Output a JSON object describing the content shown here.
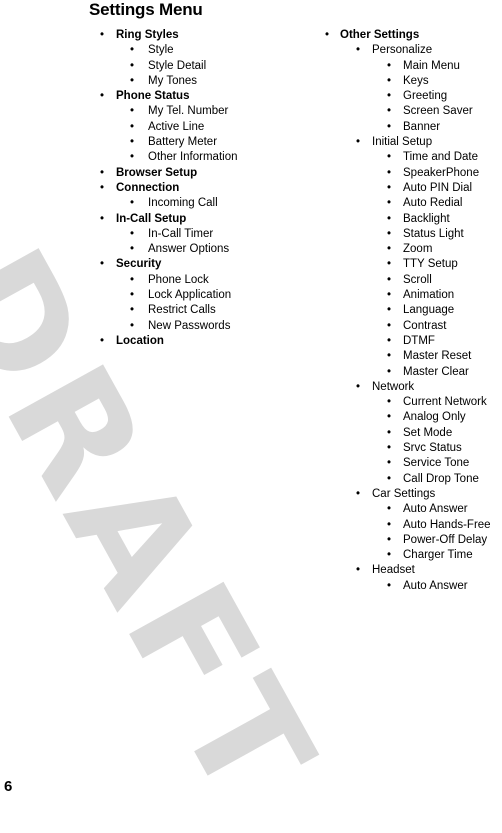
{
  "page": {
    "title": "Settings Menu",
    "page_number": "6",
    "watermark": "DRAFT",
    "watermark_color": "#d9d9d9",
    "text_color": "#000000",
    "background_color": "#ffffff"
  },
  "bullet_glyph": "•",
  "columns": [
    {
      "id": "left",
      "items": [
        {
          "level": 1,
          "label": "Ring Styles"
        },
        {
          "level": 2,
          "label": "Style"
        },
        {
          "level": 2,
          "label": "Style Detail"
        },
        {
          "level": 2,
          "label": "My Tones"
        },
        {
          "level": 1,
          "label": "Phone Status"
        },
        {
          "level": 2,
          "label": "My Tel. Number"
        },
        {
          "level": 2,
          "label": "Active Line"
        },
        {
          "level": 2,
          "label": "Battery Meter"
        },
        {
          "level": 2,
          "label": "Other Information"
        },
        {
          "level": 1,
          "label": "Browser Setup"
        },
        {
          "level": 1,
          "label": "Connection"
        },
        {
          "level": 2,
          "label": "Incoming Call"
        },
        {
          "level": 1,
          "label": "In-Call Setup"
        },
        {
          "level": 2,
          "label": "In-Call Timer"
        },
        {
          "level": 2,
          "label": "Answer Options"
        },
        {
          "level": 1,
          "label": "Security"
        },
        {
          "level": 2,
          "label": "Phone Lock"
        },
        {
          "level": 2,
          "label": "Lock Application"
        },
        {
          "level": 2,
          "label": "Restrict Calls"
        },
        {
          "level": 2,
          "label": "New Passwords"
        },
        {
          "level": 1,
          "label": "Location"
        }
      ]
    },
    {
      "id": "right",
      "items": [
        {
          "level": 1,
          "label": "Other Settings"
        },
        {
          "level": 2,
          "label": "Personalize"
        },
        {
          "level": 3,
          "label": "Main Menu"
        },
        {
          "level": 3,
          "label": "Keys"
        },
        {
          "level": 3,
          "label": "Greeting"
        },
        {
          "level": 3,
          "label": "Screen Saver"
        },
        {
          "level": 3,
          "label": "Banner"
        },
        {
          "level": 2,
          "label": "Initial Setup"
        },
        {
          "level": 3,
          "label": "Time and Date"
        },
        {
          "level": 3,
          "label": "SpeakerPhone"
        },
        {
          "level": 3,
          "label": "Auto PIN Dial"
        },
        {
          "level": 3,
          "label": "Auto Redial"
        },
        {
          "level": 3,
          "label": "Backlight"
        },
        {
          "level": 3,
          "label": "Status Light"
        },
        {
          "level": 3,
          "label": "Zoom"
        },
        {
          "level": 3,
          "label": "TTY Setup"
        },
        {
          "level": 3,
          "label": "Scroll"
        },
        {
          "level": 3,
          "label": "Animation"
        },
        {
          "level": 3,
          "label": "Language"
        },
        {
          "level": 3,
          "label": "Contrast"
        },
        {
          "level": 3,
          "label": "DTMF"
        },
        {
          "level": 3,
          "label": "Master Reset"
        },
        {
          "level": 3,
          "label": "Master Clear"
        },
        {
          "level": 2,
          "label": "Network"
        },
        {
          "level": 3,
          "label": "Current Network"
        },
        {
          "level": 3,
          "label": "Analog Only"
        },
        {
          "level": 3,
          "label": "Set Mode"
        },
        {
          "level": 3,
          "label": "Srvc Status"
        },
        {
          "level": 3,
          "label": "Service Tone"
        },
        {
          "level": 3,
          "label": "Call Drop Tone"
        },
        {
          "level": 2,
          "label": "Car Settings"
        },
        {
          "level": 3,
          "label": "Auto Answer"
        },
        {
          "level": 3,
          "label": "Auto Hands-Free"
        },
        {
          "level": 3,
          "label": "Power-Off Delay"
        },
        {
          "level": 3,
          "label": "Charger Time"
        },
        {
          "level": 2,
          "label": "Headset"
        },
        {
          "level": 3,
          "label": "Auto Answer"
        }
      ]
    }
  ]
}
